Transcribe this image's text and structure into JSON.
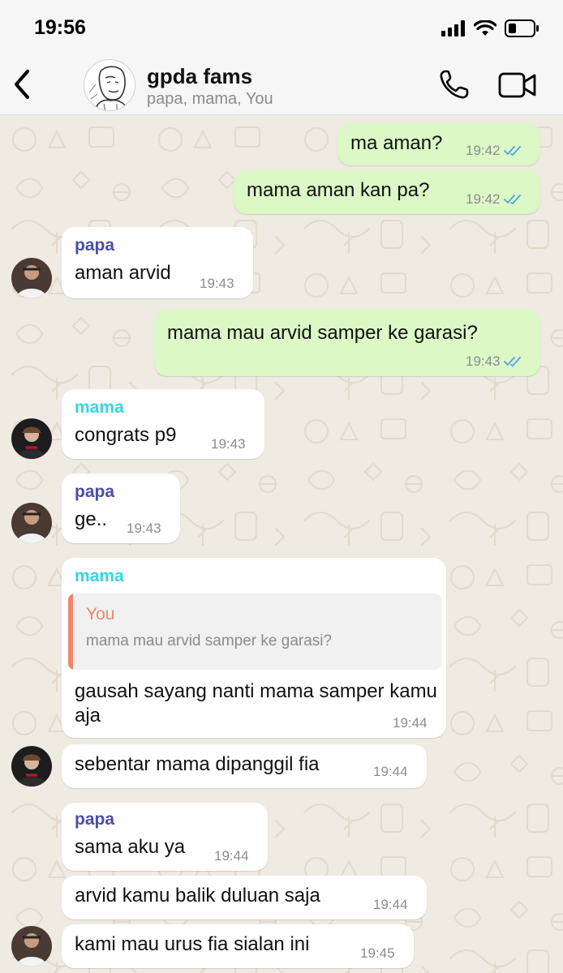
{
  "status_bar": {
    "time": "19:56"
  },
  "header": {
    "title": "gpda fams",
    "subtitle": "papa, mama, You"
  },
  "messages": [
    {
      "type": "outgoing",
      "text": "ma aman?",
      "time": "19:42",
      "status": "read"
    },
    {
      "type": "outgoing",
      "text": "mama aman kan pa?",
      "time": "19:42",
      "status": "read"
    },
    {
      "type": "incoming",
      "sender": "papa",
      "text": "aman arvid",
      "time": "19:43"
    },
    {
      "type": "outgoing",
      "text": "mama mau arvid samper ke garasi?",
      "time": "19:43",
      "status": "read"
    },
    {
      "type": "incoming",
      "sender": "mama",
      "text": "congrats p9",
      "time": "19:43"
    },
    {
      "type": "incoming",
      "sender": "papa",
      "text": "ge..",
      "time": "19:43"
    },
    {
      "type": "incoming",
      "sender": "mama",
      "quote_name": "You",
      "quote_text": "mama mau arvid samper ke garasi?",
      "text": "gausah sayang nanti mama samper kamu aja",
      "time": "19:44"
    },
    {
      "type": "incoming",
      "text": "sebentar mama dipanggil fia",
      "time": "19:44"
    },
    {
      "type": "incoming",
      "sender": "papa",
      "text": "sama aku ya",
      "time": "19:44"
    },
    {
      "type": "incoming",
      "text": "arvid kamu balik duluan saja",
      "time": "19:44"
    },
    {
      "type": "incoming",
      "text": "kami mau urus fia sialan ini",
      "time": "19:45"
    }
  ],
  "colors": {
    "outgoing_bubble": "#dbf8c6",
    "incoming_bubble": "#ffffff",
    "papa_name": "#4a4ea8",
    "mama_name": "#35d6e6",
    "quote_accent": "#f1866b",
    "read_tick": "#4fa3e0"
  },
  "icons": [
    "back-icon",
    "phone-icon",
    "video-icon",
    "signal-icon",
    "wifi-icon",
    "battery-icon",
    "double-check-icon"
  ]
}
